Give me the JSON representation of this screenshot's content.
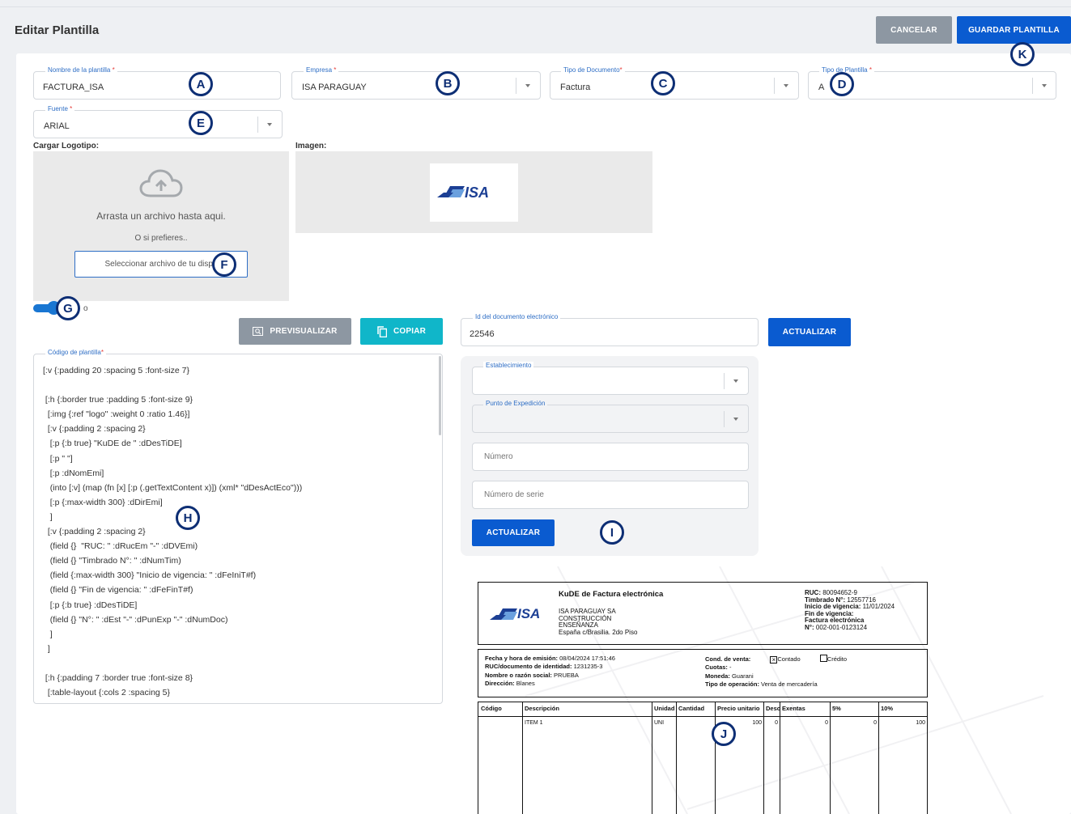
{
  "header": {
    "title": "Editar Plantilla",
    "cancel_label": "CANCELAR",
    "save_label": "GUARDAR PLANTILLA"
  },
  "form": {
    "template_name": {
      "label": "Nombre de la plantilla",
      "required_mark": "*",
      "value": "FACTURA_ISA"
    },
    "company": {
      "label": "Empresa",
      "required_mark": "*",
      "value": "ISA PARAGUAY"
    },
    "doc_type": {
      "label": "Tipo de Documento",
      "required_mark": "*",
      "value": "Factura"
    },
    "template_type": {
      "label": "Tipo de Plantilla",
      "required_mark": "*",
      "value": "A"
    },
    "font": {
      "label": "Fuente",
      "required_mark": "*",
      "value": "ARIAL"
    }
  },
  "logo_upload": {
    "label": "Cargar Logotipo:",
    "drag_text": "Arrasta un archivo hasta aqui.",
    "or_text": "O si prefieres..",
    "select_button": "Seleccionar archivo de tu dispo"
  },
  "image_section": {
    "label": "Imagen:",
    "logo_text": "ISA"
  },
  "toggle": {
    "label": "o",
    "on": true
  },
  "actions": {
    "preview_label": "PREVISUALIZAR",
    "copy_label": "COPIAR"
  },
  "code_editor": {
    "label": "Código de plantilla",
    "required_mark": "*",
    "lines": [
      "[:v {:padding 20 :spacing 5 :font-size 7}",
      "",
      " [:h {:border true :padding 5 :font-size 9}",
      "  [:img {:ref \"logo\" :weight 0 :ratio 1.46}]",
      "  [:v {:padding 2 :spacing 2}",
      "   [:p {:b true} \"KuDE de \" :dDesTiDE]",
      "   [:p \" \"]",
      "   [:p :dNomEmi]",
      "   (into [:v] (map (fn [x] [:p (.getTextContent x)]) (xml* \"dDesActEco\")))",
      "   [:p {:max-width 300} :dDirEmi]",
      "   ]",
      "  [:v {:padding 2 :spacing 2}",
      "   (field {}  \"RUC: \" :dRucEm \"-\" :dDVEmi)",
      "   (field {} \"Timbrado N°: \" :dNumTim)",
      "   (field {:max-width 300} \"Inicio de vigencia: \" :dFeIniT#f)",
      "   (field {} \"Fin de vigencia: \" :dFeFinT#f)",
      "   [:p {:b true} :dDesTiDE]",
      "   (field {} \"N°: \" :dEst \"-\" :dPunExp \"-\" :dNumDoc)",
      "   ]",
      "  ]",
      "",
      " [:h {:padding 7 :border true :font-size 8}",
      "  [:table-layout {:cols 2 :spacing 5}"
    ]
  },
  "doc_id": {
    "label": "Id del documento electrónico",
    "value": "22546",
    "update_label": "ACTUALIZAR"
  },
  "filters": {
    "establishment": {
      "label": "Establecimiento",
      "value": ""
    },
    "expedition_point": {
      "label": "Punto de Expedición",
      "value": ""
    },
    "number_placeholder": "Número",
    "serial_placeholder": "Número de serie",
    "update_label": "ACTUALIZAR"
  },
  "markers": [
    "A",
    "B",
    "C",
    "D",
    "E",
    "F",
    "G",
    "H",
    "I",
    "J",
    "K"
  ],
  "preview": {
    "logo_text": "ISA",
    "title": "KuDE de Factura electrónica",
    "company_lines": [
      "ISA PARAGUAY SA",
      "CONSTRUCCIÓN",
      "ENSEÑANZA",
      "España c/Brasilia. 2do Piso"
    ],
    "ruc_label": "RUC:",
    "ruc_value": "80094652-9",
    "timbrado_label": "Timbrado N°:",
    "timbrado_value": "12557716",
    "inicio_label": "Inicio de vigencia:",
    "inicio_value": "11/01/2024",
    "fin_label": "Fin de vigencia:",
    "doc_type": "Factura electrónica",
    "num_label": "N°:",
    "num_value": "002-001-0123124",
    "fecha_label": "Fecha y hora de emisión:",
    "fecha_value": "08/04/2024 17:51:46",
    "ruc_doc_label": "RUC/documento de identidad:",
    "ruc_doc_value": "1231235-3",
    "nombre_label": "Nombre o razón social:",
    "nombre_value": "PRUEBA",
    "direccion_label": "Dirección:",
    "direccion_value": "Blanes",
    "cond_label": "Cond. de venta:",
    "contado_label": "Contado",
    "credito_label": "Crédito",
    "cuotas_label": "Cuotas:",
    "cuotas_value": "-",
    "moneda_label": "Moneda:",
    "moneda_value": "Guarani",
    "tipo_op_label": "Tipo de operación:",
    "tipo_op_value": "Venta de mercadería",
    "table_headers": [
      "Código",
      "Descripción",
      "Unidad",
      "Cantidad",
      "Precio unitario",
      "Desc.",
      "Exentas",
      "5%",
      "10%"
    ],
    "row": [
      "",
      "ITEM 1",
      "UNI",
      "",
      "100",
      "0",
      "0",
      "0",
      "100"
    ]
  }
}
